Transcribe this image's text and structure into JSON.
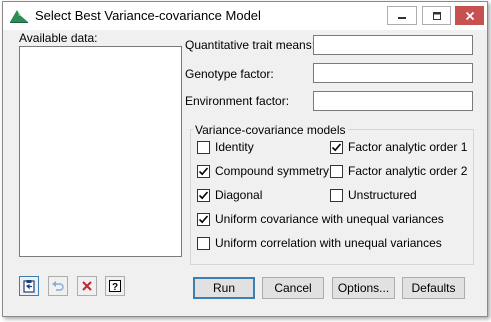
{
  "window": {
    "title": "Select Best Variance-covariance Model"
  },
  "available_data_label": "Available data:",
  "fields": {
    "trait_label": "Quantitative trait means:",
    "trait_value": "",
    "genotype_label": "Genotype factor:",
    "genotype_value": "",
    "environment_label": "Environment factor:",
    "environment_value": ""
  },
  "models_group": {
    "title": "Variance-covariance models",
    "options": [
      {
        "label": "Identity",
        "checked": false
      },
      {
        "label": "Factor analytic order 1",
        "checked": true
      },
      {
        "label": "Compound symmetry",
        "checked": true
      },
      {
        "label": "Factor analytic order 2",
        "checked": false
      },
      {
        "label": "Diagonal",
        "checked": true
      },
      {
        "label": "Unstructured",
        "checked": false
      },
      {
        "label": "Uniform covariance with unequal variances",
        "checked": true
      },
      {
        "label": "Uniform correlation with unequal variances",
        "checked": false
      }
    ]
  },
  "buttons": {
    "run": "Run",
    "cancel": "Cancel",
    "options": "Options...",
    "defaults": "Defaults"
  },
  "tools": [
    "clipboard-icon",
    "undo-icon",
    "clear-icon",
    "help-icon"
  ],
  "colors": {
    "close_button": "#c75050",
    "default_button_border": "#3c7fb1",
    "checkmark": "#000000"
  }
}
